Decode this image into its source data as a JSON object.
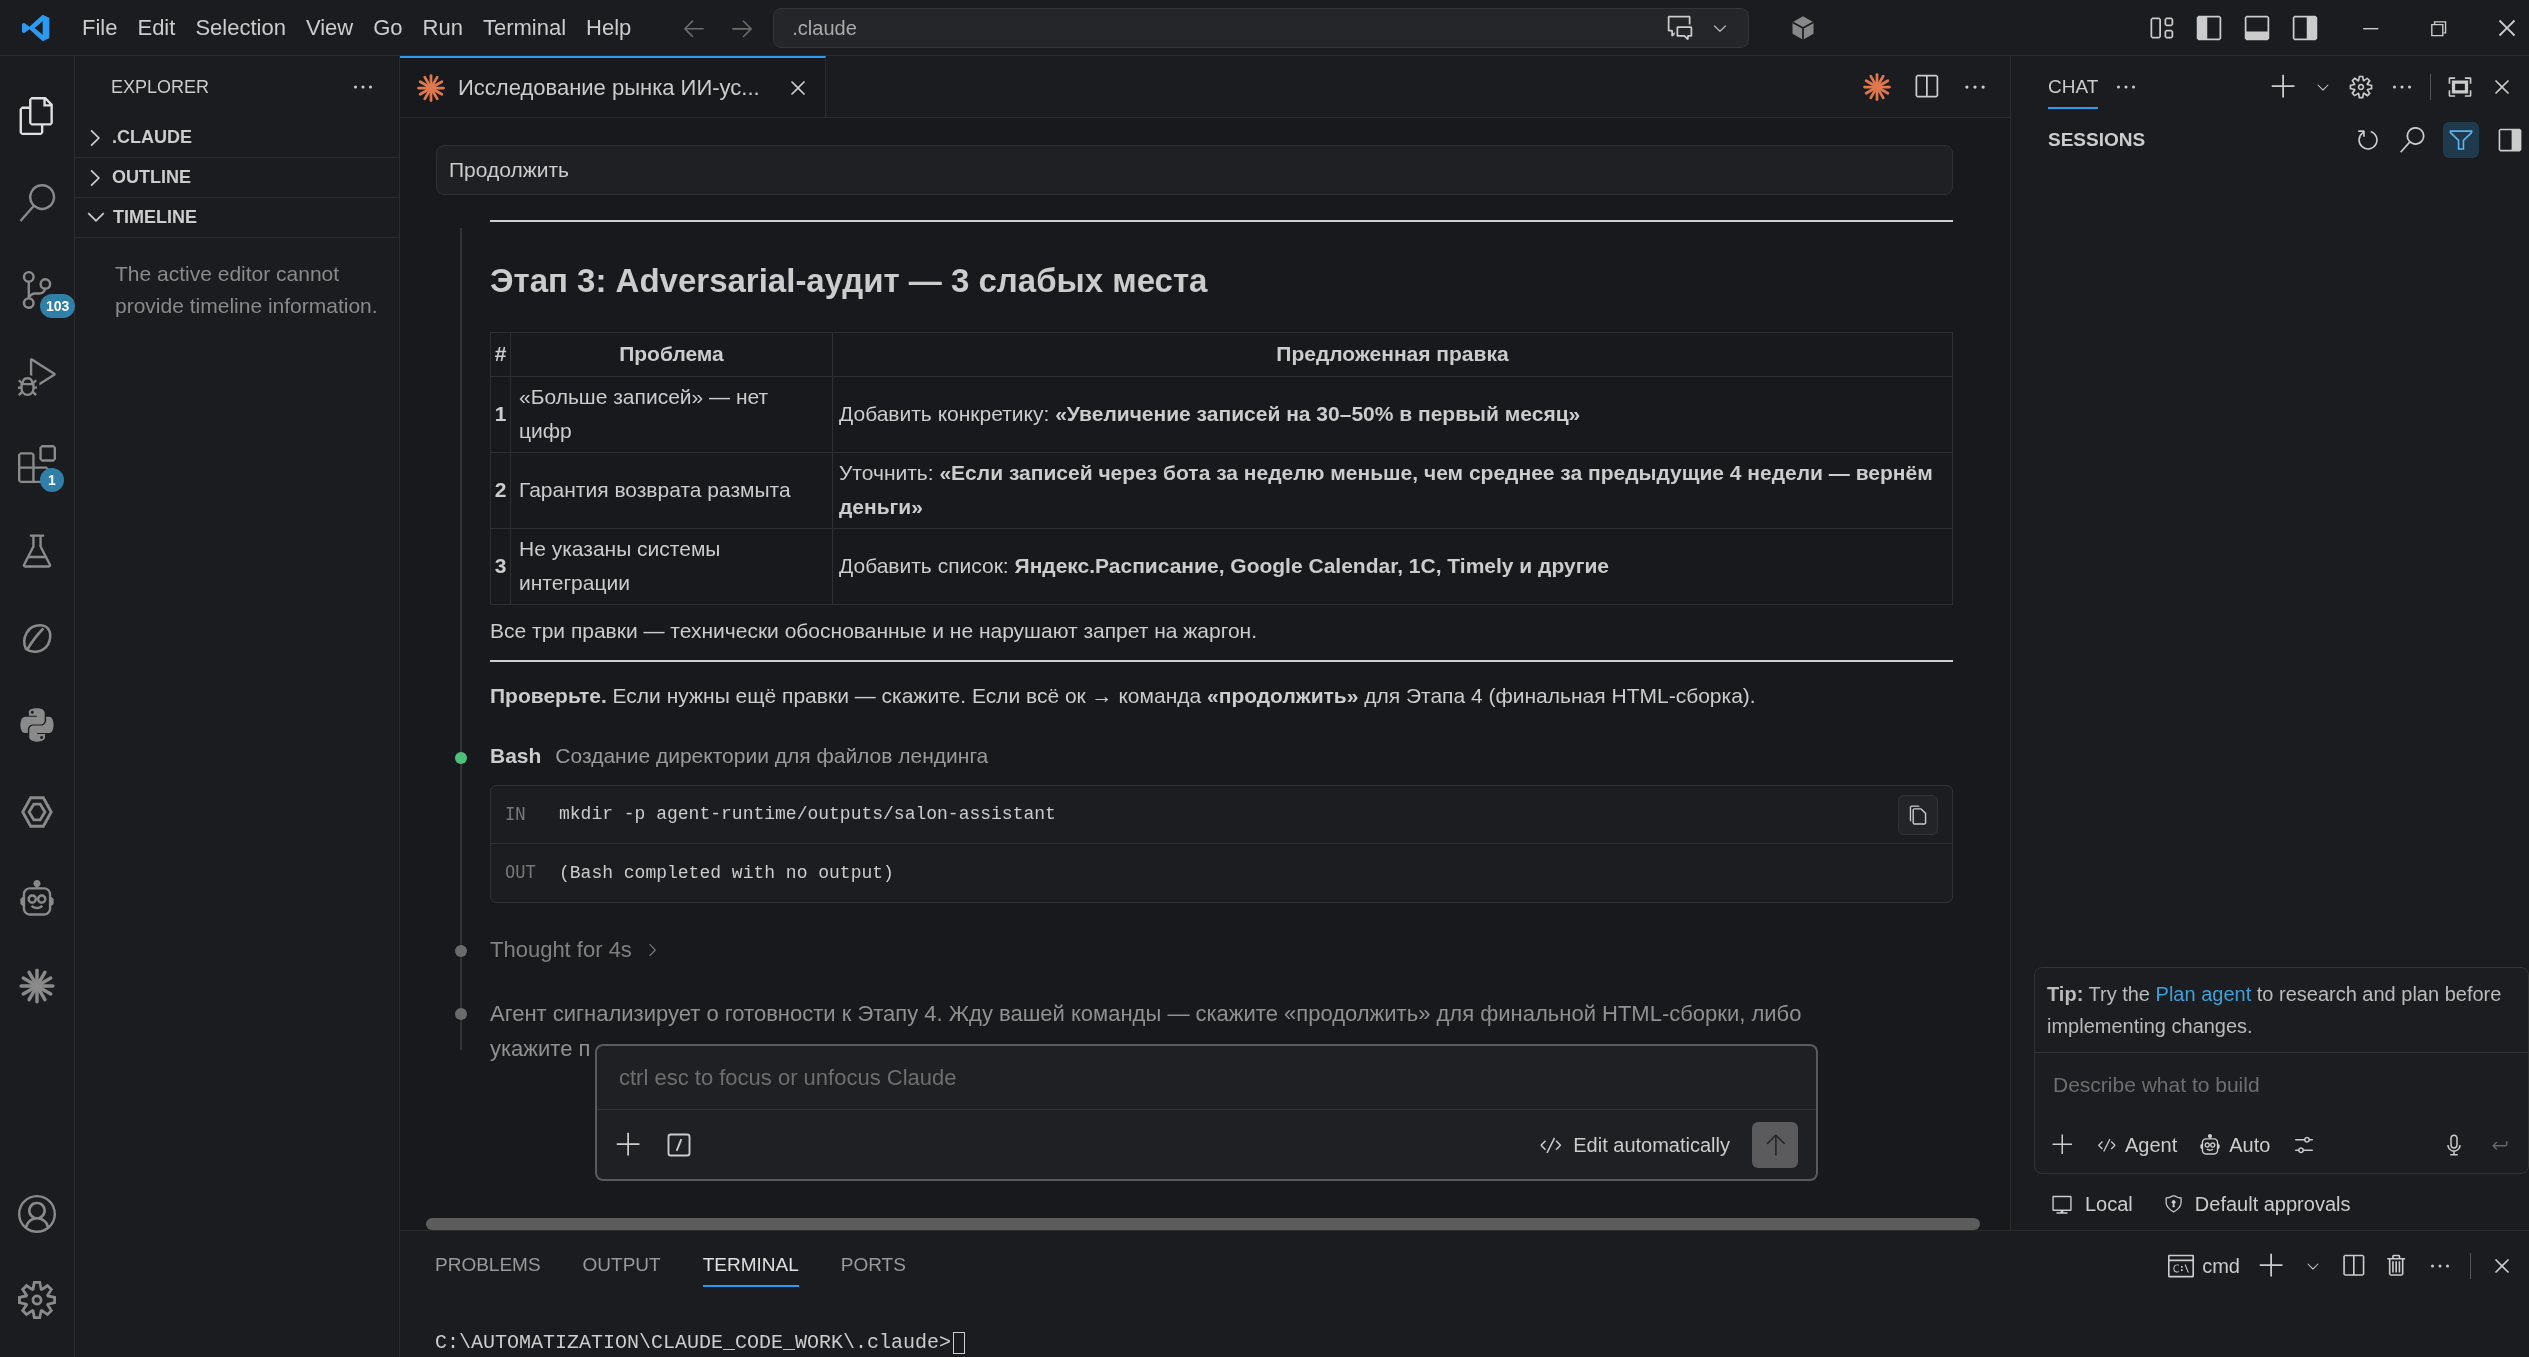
{
  "menu": [
    "File",
    "Edit",
    "Selection",
    "View",
    "Go",
    "Run",
    "Terminal",
    "Help"
  ],
  "command_center": {
    "value": ".claude"
  },
  "activity_bar": [
    {
      "kind": "explorer",
      "selected": true
    },
    {
      "kind": "search",
      "selected": false
    },
    {
      "kind": "source-control",
      "selected": false,
      "badge": "103"
    },
    {
      "kind": "run-debug",
      "selected": false
    },
    {
      "kind": "extensions",
      "selected": false,
      "badge": "1"
    },
    {
      "kind": "testing",
      "selected": false
    },
    {
      "kind": "leaf",
      "selected": false
    },
    {
      "kind": "python",
      "selected": false
    },
    {
      "kind": "hexagon",
      "selected": false
    },
    {
      "kind": "robot",
      "selected": false
    },
    {
      "kind": "sunburst",
      "selected": false
    }
  ],
  "activity_bottom": [
    {
      "kind": "account"
    },
    {
      "kind": "settings"
    }
  ],
  "sidebar": {
    "title": "EXPLORER",
    "sections": [
      {
        "label": ".CLAUDE",
        "expanded": false
      },
      {
        "label": "OUTLINE",
        "expanded": false
      },
      {
        "label": "TIMELINE",
        "expanded": true
      }
    ],
    "timeline_message": "The active editor cannot provide timeline information."
  },
  "editor": {
    "tab": {
      "label": "Исследование рынка ИИ-ус..."
    },
    "prompt": "Продолжить",
    "heading": "Этап 3: Adversarial-аудит — 3 слабых места",
    "table": {
      "columns": [
        "#",
        "Проблема",
        "Предложенная правка"
      ],
      "rows": [
        {
          "num": "1",
          "problem": "«Больше записей» — нет цифр",
          "fix": "Добавить конкретику: **«Увеличение записей на 30–50% в первый месяц»**"
        },
        {
          "num": "2",
          "problem": "Гарантия возврата размыта",
          "fix": "Уточнить: **«Если записей через бота за неделю меньше, чем среднее за предыдущие 4 недели — вернём деньги»**"
        },
        {
          "num": "3",
          "problem": "Не указаны системы интеграции",
          "fix": "Добавить список: **Яндекс.Расписание, Google Calendar, 1С, Timely и другие**"
        }
      ]
    },
    "summary": "Все три правки — технически обоснованные и не нарушают запрет на жаргон.",
    "check": "**Проверьте.** Если нужны ещё правки — скажите. Если всё ок → команда **«продолжить»** для Этапа 4 (финальная HTML-сборка).",
    "steps": [
      {
        "kind": "tool",
        "color": "#4fc07a",
        "tool": "Bash",
        "description": "Создание директории для файлов лендинга",
        "input_label": "IN",
        "command": "mkdir -p agent-runtime/outputs/salon-assistant",
        "output_label": "OUT",
        "output": "(Bash completed with no output)"
      },
      {
        "kind": "thought",
        "color": "#6b6b6b",
        "label": "Thought for 4s"
      },
      {
        "kind": "message",
        "color": "#6b6b6b",
        "lines": [
          "Агент сигнализирует о готовности к Этапу 4. Жду вашей команды — скажите «продолжить» для финальной HTML-сборки, либо",
          "укажите п"
        ]
      }
    ]
  },
  "composer": {
    "placeholder": "ctrl esc to focus or unfocus Claude",
    "mode": "Edit automatically"
  },
  "chat": {
    "tab": "CHAT",
    "sessions_title": "SESSIONS",
    "filter_on": true,
    "tip_label": "Tip:",
    "tip_before": "Try the",
    "tip_link": "Plan agent",
    "tip_after": "to research and plan before implementing changes.",
    "input_placeholder": "Describe what to build",
    "agent": "Agent",
    "model": "Auto",
    "location": "Local",
    "approvals": "Default approvals"
  },
  "panel": {
    "tabs": [
      {
        "label": "PROBLEMS",
        "selected": false
      },
      {
        "label": "OUTPUT",
        "selected": false
      },
      {
        "label": "TERMINAL",
        "selected": true
      },
      {
        "label": "PORTS",
        "selected": false
      }
    ],
    "terminal_name": "cmd",
    "terminal_line": "C:\\AUTOMATIZATION\\CLAUDE_CODE_WORK\\.claude>"
  }
}
